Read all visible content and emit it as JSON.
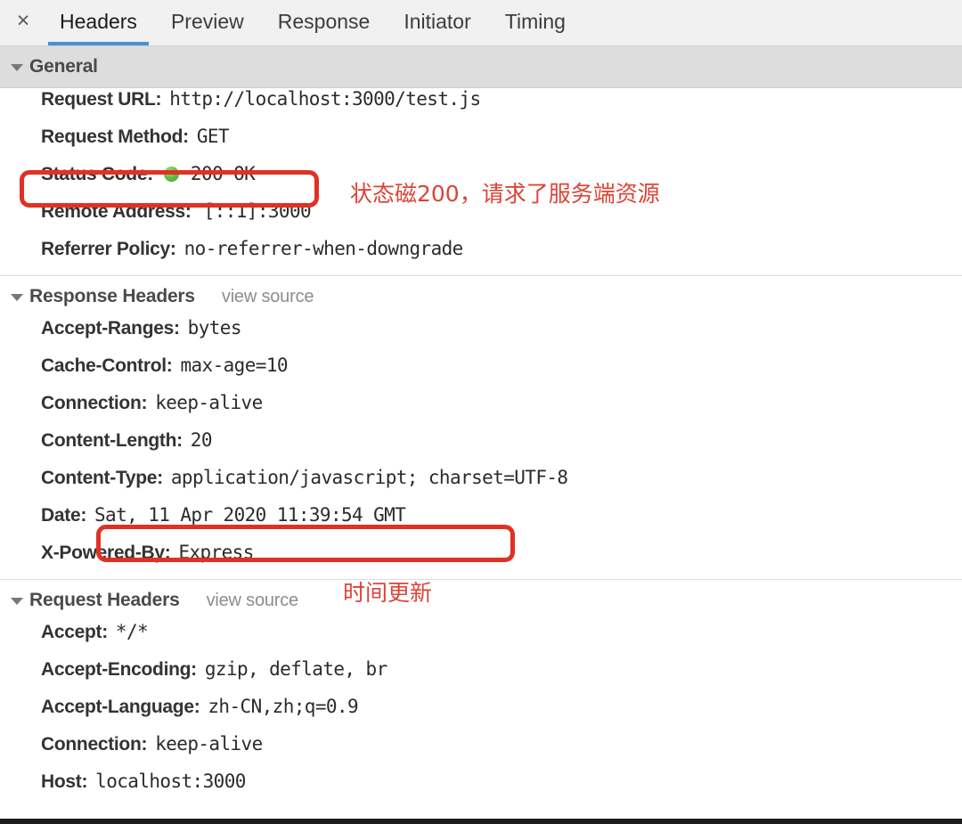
{
  "tabbar": {
    "close_label": "×",
    "tabs": [
      {
        "label": "Headers",
        "active": true
      },
      {
        "label": "Preview",
        "active": false
      },
      {
        "label": "Response",
        "active": false
      },
      {
        "label": "Initiator",
        "active": false
      },
      {
        "label": "Timing",
        "active": false
      }
    ]
  },
  "sections": {
    "general": {
      "title": "General",
      "rows": [
        {
          "name": "Request URL:",
          "value": "http://localhost:3000/test.js"
        },
        {
          "name": "Request Method:",
          "value": "GET"
        },
        {
          "name": "Status Code:",
          "value": "200 OK",
          "has_dot": true
        },
        {
          "name": "Remote Address:",
          "value": "[::1]:3000"
        },
        {
          "name": "Referrer Policy:",
          "value": "no-referrer-when-downgrade"
        }
      ]
    },
    "response_headers": {
      "title": "Response Headers",
      "view_source": "view source",
      "rows": [
        {
          "name": "Accept-Ranges:",
          "value": "bytes"
        },
        {
          "name": "Cache-Control:",
          "value": "max-age=10"
        },
        {
          "name": "Connection:",
          "value": "keep-alive"
        },
        {
          "name": "Content-Length:",
          "value": "20"
        },
        {
          "name": "Content-Type:",
          "value": "application/javascript; charset=UTF-8"
        },
        {
          "name": "Date:",
          "value": "Sat, 11 Apr 2020 11:39:54 GMT"
        },
        {
          "name": "X-Powered-By:",
          "value": "Express"
        }
      ]
    },
    "request_headers": {
      "title": "Request Headers",
      "view_source": "view source",
      "rows": [
        {
          "name": "Accept:",
          "value": "*/*"
        },
        {
          "name": "Accept-Encoding:",
          "value": "gzip, deflate, br"
        },
        {
          "name": "Accept-Language:",
          "value": "zh-CN,zh;q=0.9"
        },
        {
          "name": "Connection:",
          "value": "keep-alive"
        },
        {
          "name": "Host:",
          "value": "localhost:3000"
        }
      ]
    }
  },
  "annotations": {
    "status_note": "状态磁200，请求了服务端资源",
    "date_note": "时间更新",
    "highlight_color": "#e03124",
    "note_color": "#dd4436"
  }
}
